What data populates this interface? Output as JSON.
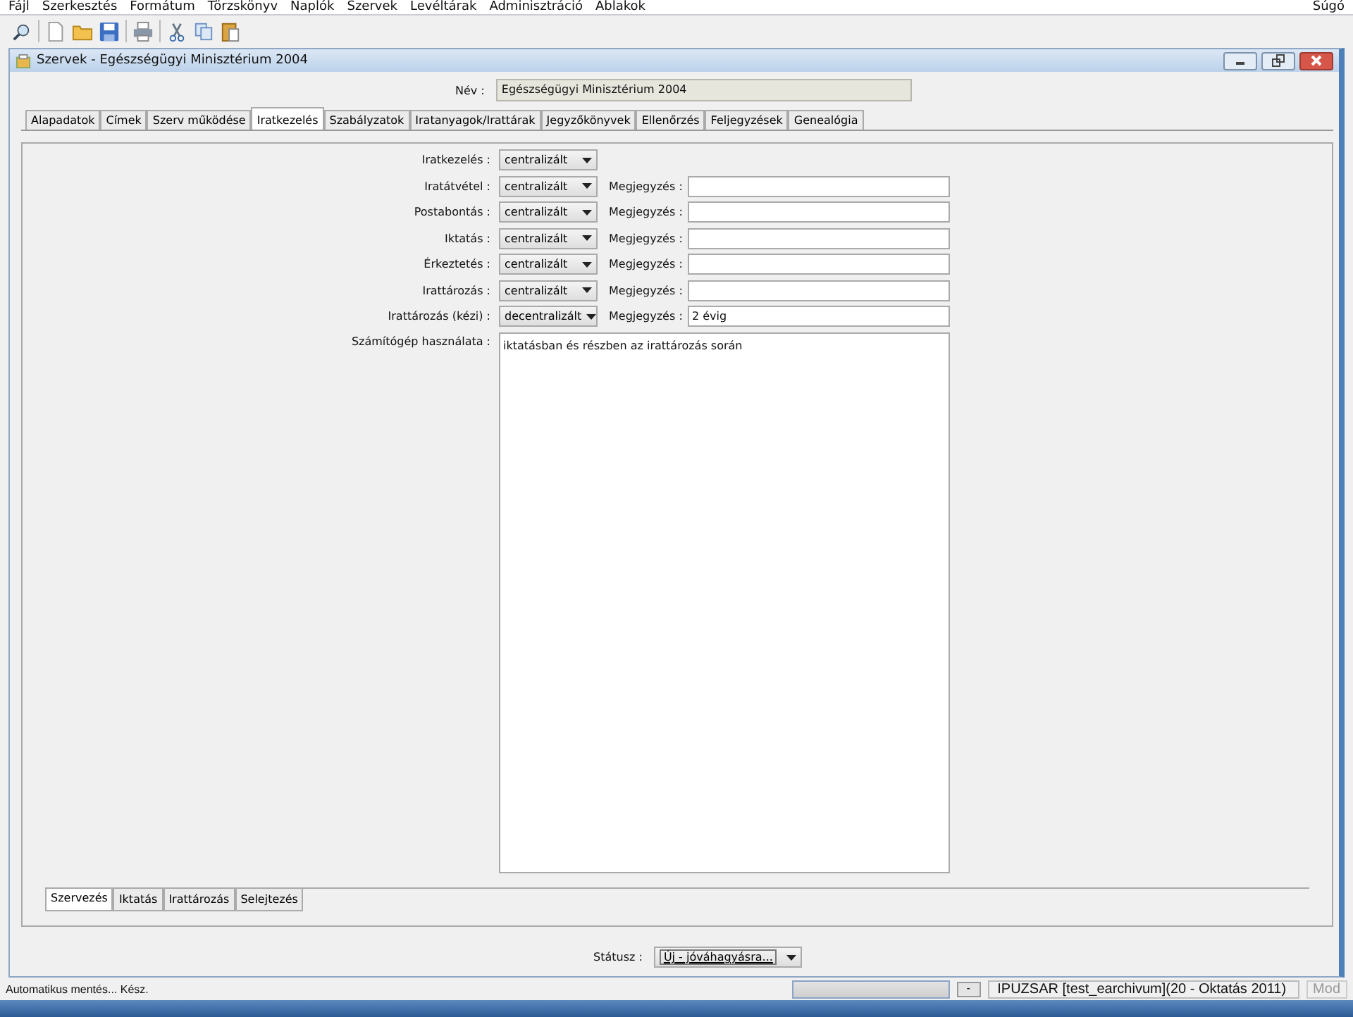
{
  "menu": [
    "Fájl",
    "Szerkesztés",
    "Formátum",
    "Törzskönyv",
    "Naplók",
    "Szervek",
    "Levéltárak",
    "Adminisztráció",
    "Ablakok"
  ],
  "help_menu": "Súgó",
  "window": {
    "title": "Szervek - Egészségügyi Minisztérium 2004"
  },
  "name_field": {
    "label": "Név :",
    "value": "Egészségügyi Minisztérium 2004"
  },
  "tabs": [
    {
      "label": "Alapadatok",
      "selected": false
    },
    {
      "label": "Címek",
      "selected": false
    },
    {
      "label": "Szerv működése",
      "selected": false
    },
    {
      "label": "Iratkezelés",
      "selected": true
    },
    {
      "label": "Szabályzatok",
      "selected": false
    },
    {
      "label": "Iratanyagok/Irattárak",
      "selected": false
    },
    {
      "label": "Jegyzőkönyvek",
      "selected": false
    },
    {
      "label": "Ellenőrzés",
      "selected": false
    },
    {
      "label": "Feljegyzések",
      "selected": false
    },
    {
      "label": "Genealógia",
      "selected": false
    }
  ],
  "form_rows": [
    {
      "label": "Iratkezelés :",
      "value": "centralizált"
    },
    {
      "label": "Iratátvétel :",
      "value": "centralizált",
      "note_label": "Megjegyzés :",
      "note_value": ""
    },
    {
      "label": "Postabontás :",
      "value": "centralizált",
      "note_label": "Megjegyzés :",
      "note_value": ""
    },
    {
      "label": "Iktatás :",
      "value": "centralizált",
      "note_label": "Megjegyzés :",
      "note_value": ""
    },
    {
      "label": "Érkeztetés :",
      "value": "centralizált",
      "note_label": "Megjegyzés :",
      "note_value": ""
    },
    {
      "label": "Irattározás :",
      "value": "centralizált",
      "note_label": "Megjegyzés :",
      "note_value": ""
    },
    {
      "label": "Irattározás (kézi) :",
      "value": "decentralizált",
      "note_label": "Megjegyzés :",
      "note_value": "2 évig"
    }
  ],
  "computer_use": {
    "label": "Számítógép használata :",
    "value": "iktatásban és részben az irattározás során"
  },
  "bottom_tabs": [
    {
      "label": "Szervezés",
      "selected": true
    },
    {
      "label": "Iktatás",
      "selected": false
    },
    {
      "label": "Irattározás",
      "selected": false
    },
    {
      "label": "Selejtezés",
      "selected": false
    }
  ],
  "status_field": {
    "label": "Státusz :",
    "value": "Új - jóváhagyásra..."
  },
  "status_bar": {
    "message": "Automatikus mentés... Kész.",
    "progress": {
      "level": 0
    },
    "minus_button": "-",
    "session": "IPUZSAR [test_earchivum](20 - Oktatás 2011)",
    "mode": "Mod"
  }
}
